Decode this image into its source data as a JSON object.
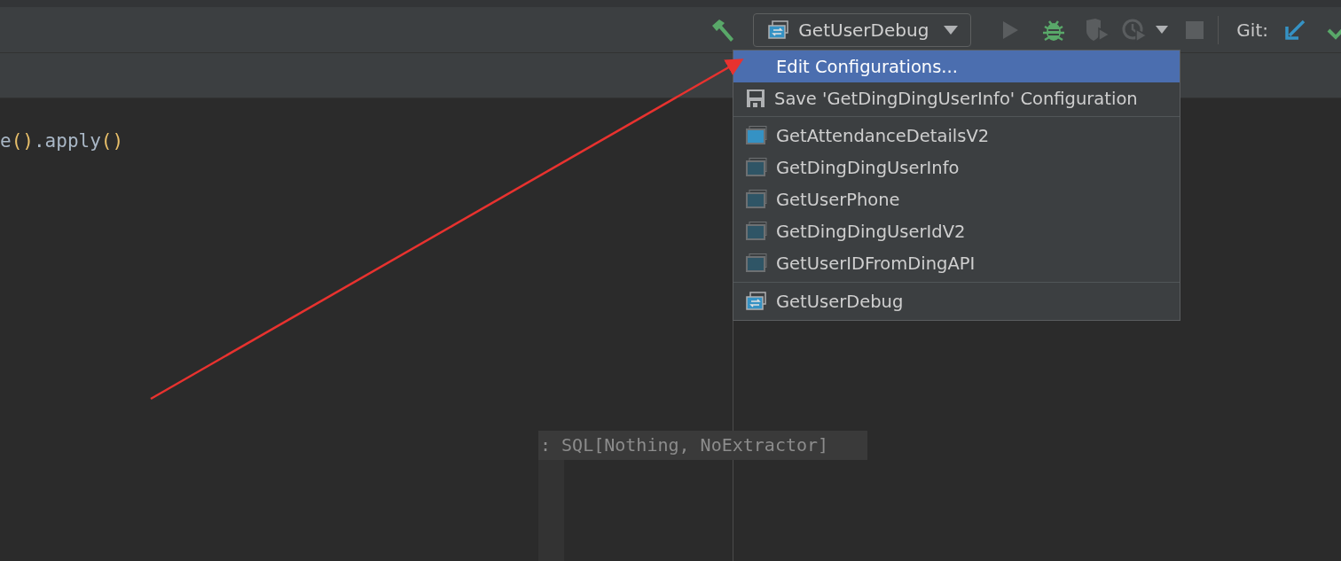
{
  "toolbar": {
    "run_config": {
      "label": "GetUserDebug"
    },
    "run_enabled": false,
    "stop_enabled": false,
    "vcs_label": "Git:"
  },
  "editor": {
    "code_tokens": [
      {
        "text": "e",
        "kind": "plain"
      },
      {
        "text": "()",
        "kind": "paren"
      },
      {
        "text": ".apply",
        "kind": "plain"
      },
      {
        "text": "()",
        "kind": "paren"
      }
    ],
    "hint": ": SQL[Nothing, NoExtractor]"
  },
  "menu": {
    "sections": [
      {
        "items": [
          {
            "label": "Edit Configurations...",
            "kind": "action",
            "selected": true
          },
          {
            "label": "Save 'GetDingDingUserInfo' Configuration",
            "kind": "save",
            "selected": false
          }
        ]
      },
      {
        "items": [
          {
            "label": "GetAttendanceDetailsV2",
            "kind": "config",
            "current": true,
            "selected": false
          },
          {
            "label": "GetDingDingUserInfo",
            "kind": "config",
            "current": false,
            "selected": false
          },
          {
            "label": "GetUserPhone",
            "kind": "config",
            "current": false,
            "selected": false
          },
          {
            "label": "GetDingDingUserIdV2",
            "kind": "config",
            "current": false,
            "selected": false
          },
          {
            "label": "GetUserIDFromDingAPI",
            "kind": "config",
            "current": false,
            "selected": false
          }
        ]
      },
      {
        "items": [
          {
            "label": "GetUserDebug",
            "kind": "compound",
            "selected": false
          }
        ]
      }
    ]
  }
}
